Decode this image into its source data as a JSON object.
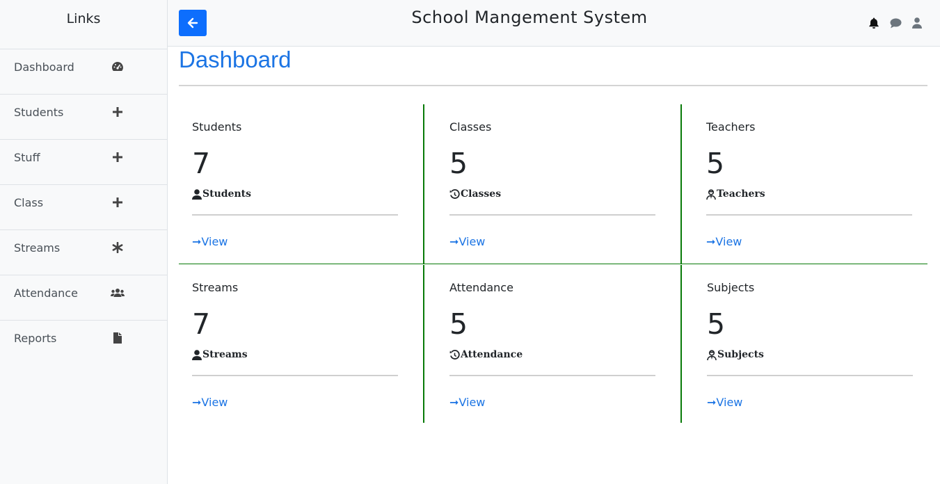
{
  "sidebar": {
    "title": "Links",
    "items": [
      {
        "label": "Dashboard",
        "icon": "tachometer-icon"
      },
      {
        "label": "Students",
        "icon": "plus-icon"
      },
      {
        "label": "Stuff",
        "icon": "plus-icon"
      },
      {
        "label": "Class",
        "icon": "plus-icon"
      },
      {
        "label": "Streams",
        "icon": "asterisk-icon"
      },
      {
        "label": "Attendance",
        "icon": "users-icon"
      },
      {
        "label": "Reports",
        "icon": "file-icon"
      }
    ]
  },
  "header": {
    "title": "School Mangement System",
    "icons": [
      "bell-icon",
      "comment-icon",
      "user-icon"
    ]
  },
  "main": {
    "page_title": "Dashboard",
    "cards": [
      {
        "label": "Students",
        "count": "7",
        "sub": "Students",
        "icon": "user-icon",
        "link": "View"
      },
      {
        "label": "Classes",
        "count": "5",
        "sub": "Classes",
        "icon": "history-icon",
        "link": "View"
      },
      {
        "label": "Teachers",
        "count": "5",
        "sub": "Teachers",
        "icon": "user-tie-icon",
        "link": "View"
      },
      {
        "label": "Streams",
        "count": "7",
        "sub": "Streams",
        "icon": "user-icon",
        "link": "View"
      },
      {
        "label": "Attendance",
        "count": "5",
        "sub": "Attendance",
        "icon": "history-icon",
        "link": "View"
      },
      {
        "label": "Subjects",
        "count": "5",
        "sub": "Subjects",
        "icon": "user-tie-icon",
        "link": "View"
      }
    ],
    "link_arrow": "➞"
  },
  "colors": {
    "accent": "#1b74e4",
    "button": "#0d6efd",
    "card_border": "#087a08",
    "sidebar_bg": "#f8f9fa"
  }
}
